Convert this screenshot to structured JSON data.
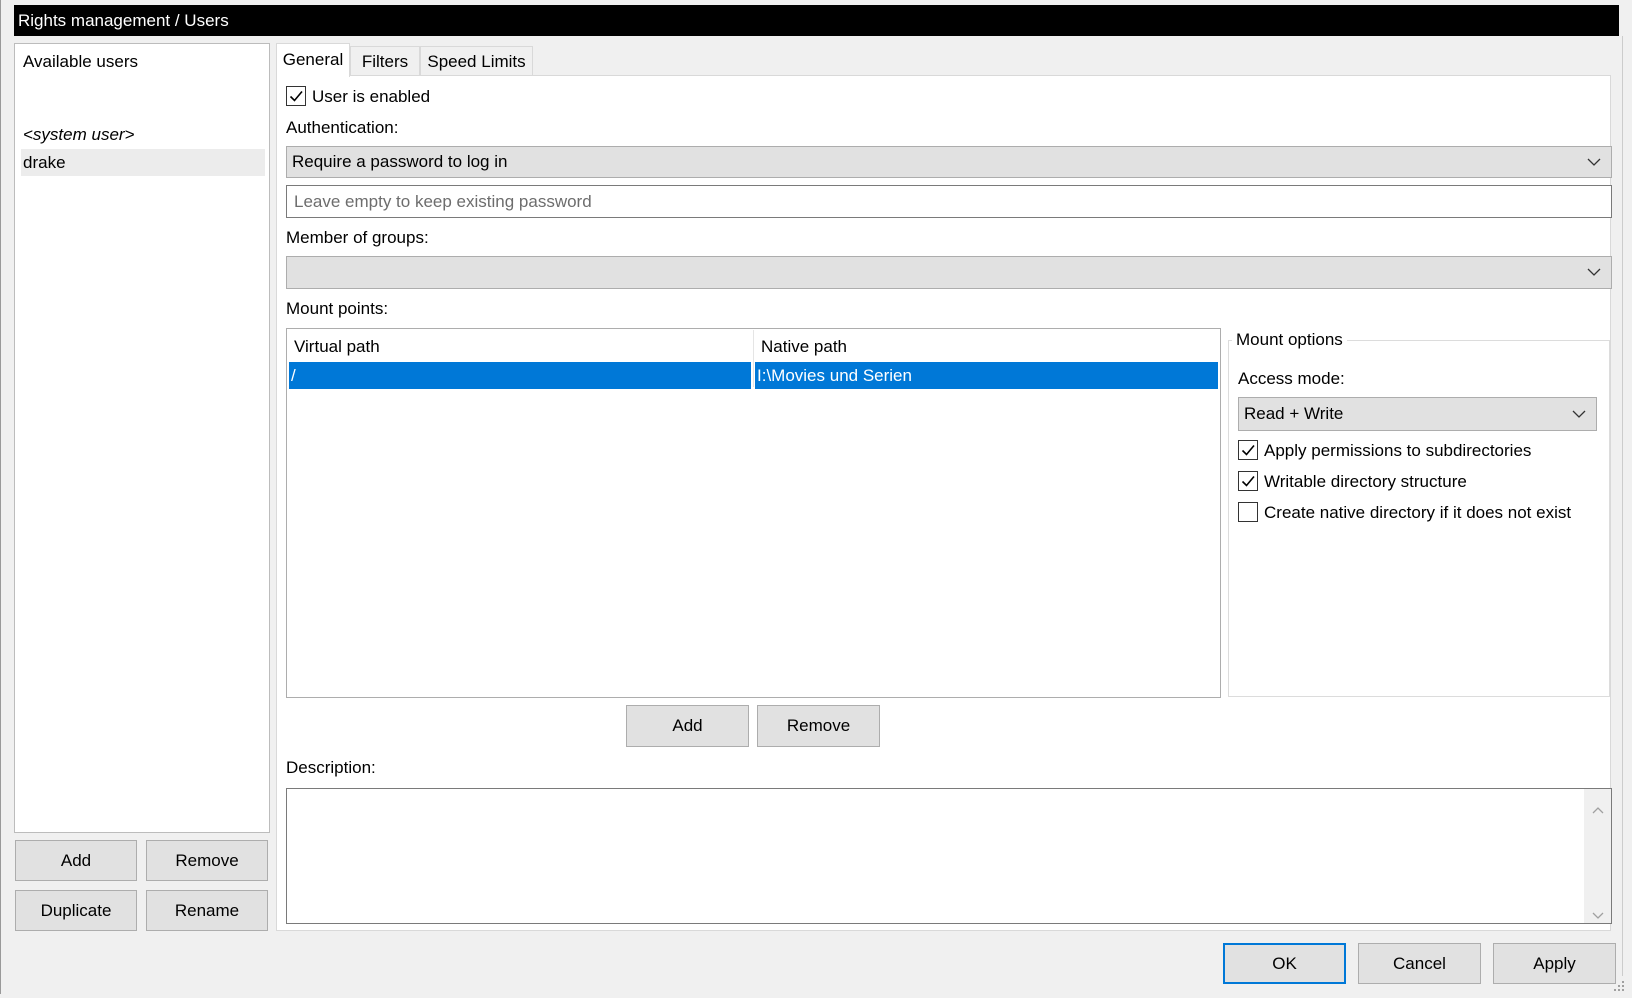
{
  "window": {
    "title": "Rights management / Users"
  },
  "users": {
    "header": "Available users",
    "items": [
      "<system user>",
      "drake"
    ],
    "buttons": {
      "add": "Add",
      "remove": "Remove",
      "duplicate": "Duplicate",
      "rename": "Rename"
    }
  },
  "tabs": [
    "General",
    "Filters",
    "Speed Limits"
  ],
  "general": {
    "user_enabled": {
      "label": "User is enabled",
      "checked": true
    },
    "authentication": {
      "label": "Authentication:",
      "selected": "Require a password to log in",
      "password_placeholder": "Leave empty to keep existing password"
    },
    "groups": {
      "label": "Member of groups:",
      "selected": ""
    },
    "mount_points": {
      "label": "Mount points:",
      "columns": [
        "Virtual path",
        "Native path"
      ],
      "rows": [
        {
          "virtual": "/",
          "native": "I:\\Movies und Serien"
        }
      ],
      "add": "Add",
      "remove": "Remove"
    },
    "mount_options": {
      "title": "Mount options",
      "access_mode_label": "Access mode:",
      "access_mode": "Read + Write",
      "checks": [
        {
          "label": "Apply permissions to subdirectories",
          "checked": true
        },
        {
          "label": "Writable directory structure",
          "checked": true
        },
        {
          "label": "Create native directory if it does not exist",
          "checked": false
        }
      ]
    },
    "description": {
      "label": "Description:",
      "value": ""
    }
  },
  "footer": {
    "ok": "OK",
    "cancel": "Cancel",
    "apply": "Apply"
  }
}
